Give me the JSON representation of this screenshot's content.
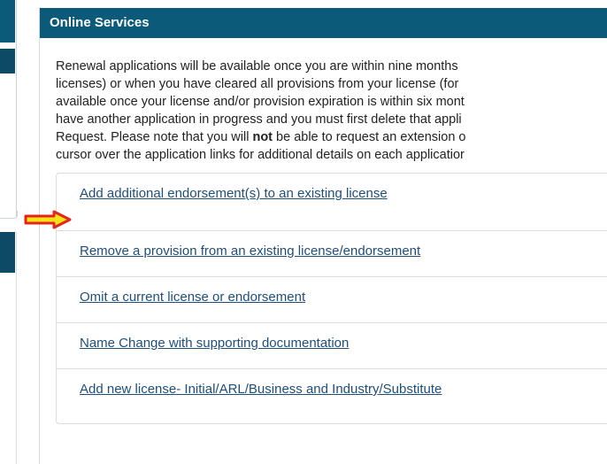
{
  "panel": {
    "title": "Online Services"
  },
  "intro": {
    "line1": "Renewal applications will be available once you are within nine months",
    "line2": "licenses) or when you have cleared all provisions from your license (for",
    "line3": "available once your license and/or provision expiration is within six mont",
    "line4": "have another application in progress and you must first delete that appli",
    "line5_a": "Request. Please note that you will ",
    "line5_bold": "not",
    "line5_b": " be able to request an extension o",
    "line6": "cursor over the application links for additional details on each applicatior"
  },
  "links": [
    {
      "label": "Add additional endorsement(s) to an existing license"
    },
    {
      "label": "Remove a provision from an existing license/endorsement"
    },
    {
      "label": "Omit a current license or endorsement"
    },
    {
      "label": "Name Change with supporting documentation"
    },
    {
      "label": "Add new license- Initial/ARL/Business and Industry/Substitute"
    }
  ],
  "colors": {
    "header_bg": "#0b5a7a",
    "link": "#1f4e79",
    "arrow_fill": "#f5e31a",
    "arrow_outline": "#e3251b"
  },
  "annotation": {
    "icon": "right-arrow-icon"
  }
}
